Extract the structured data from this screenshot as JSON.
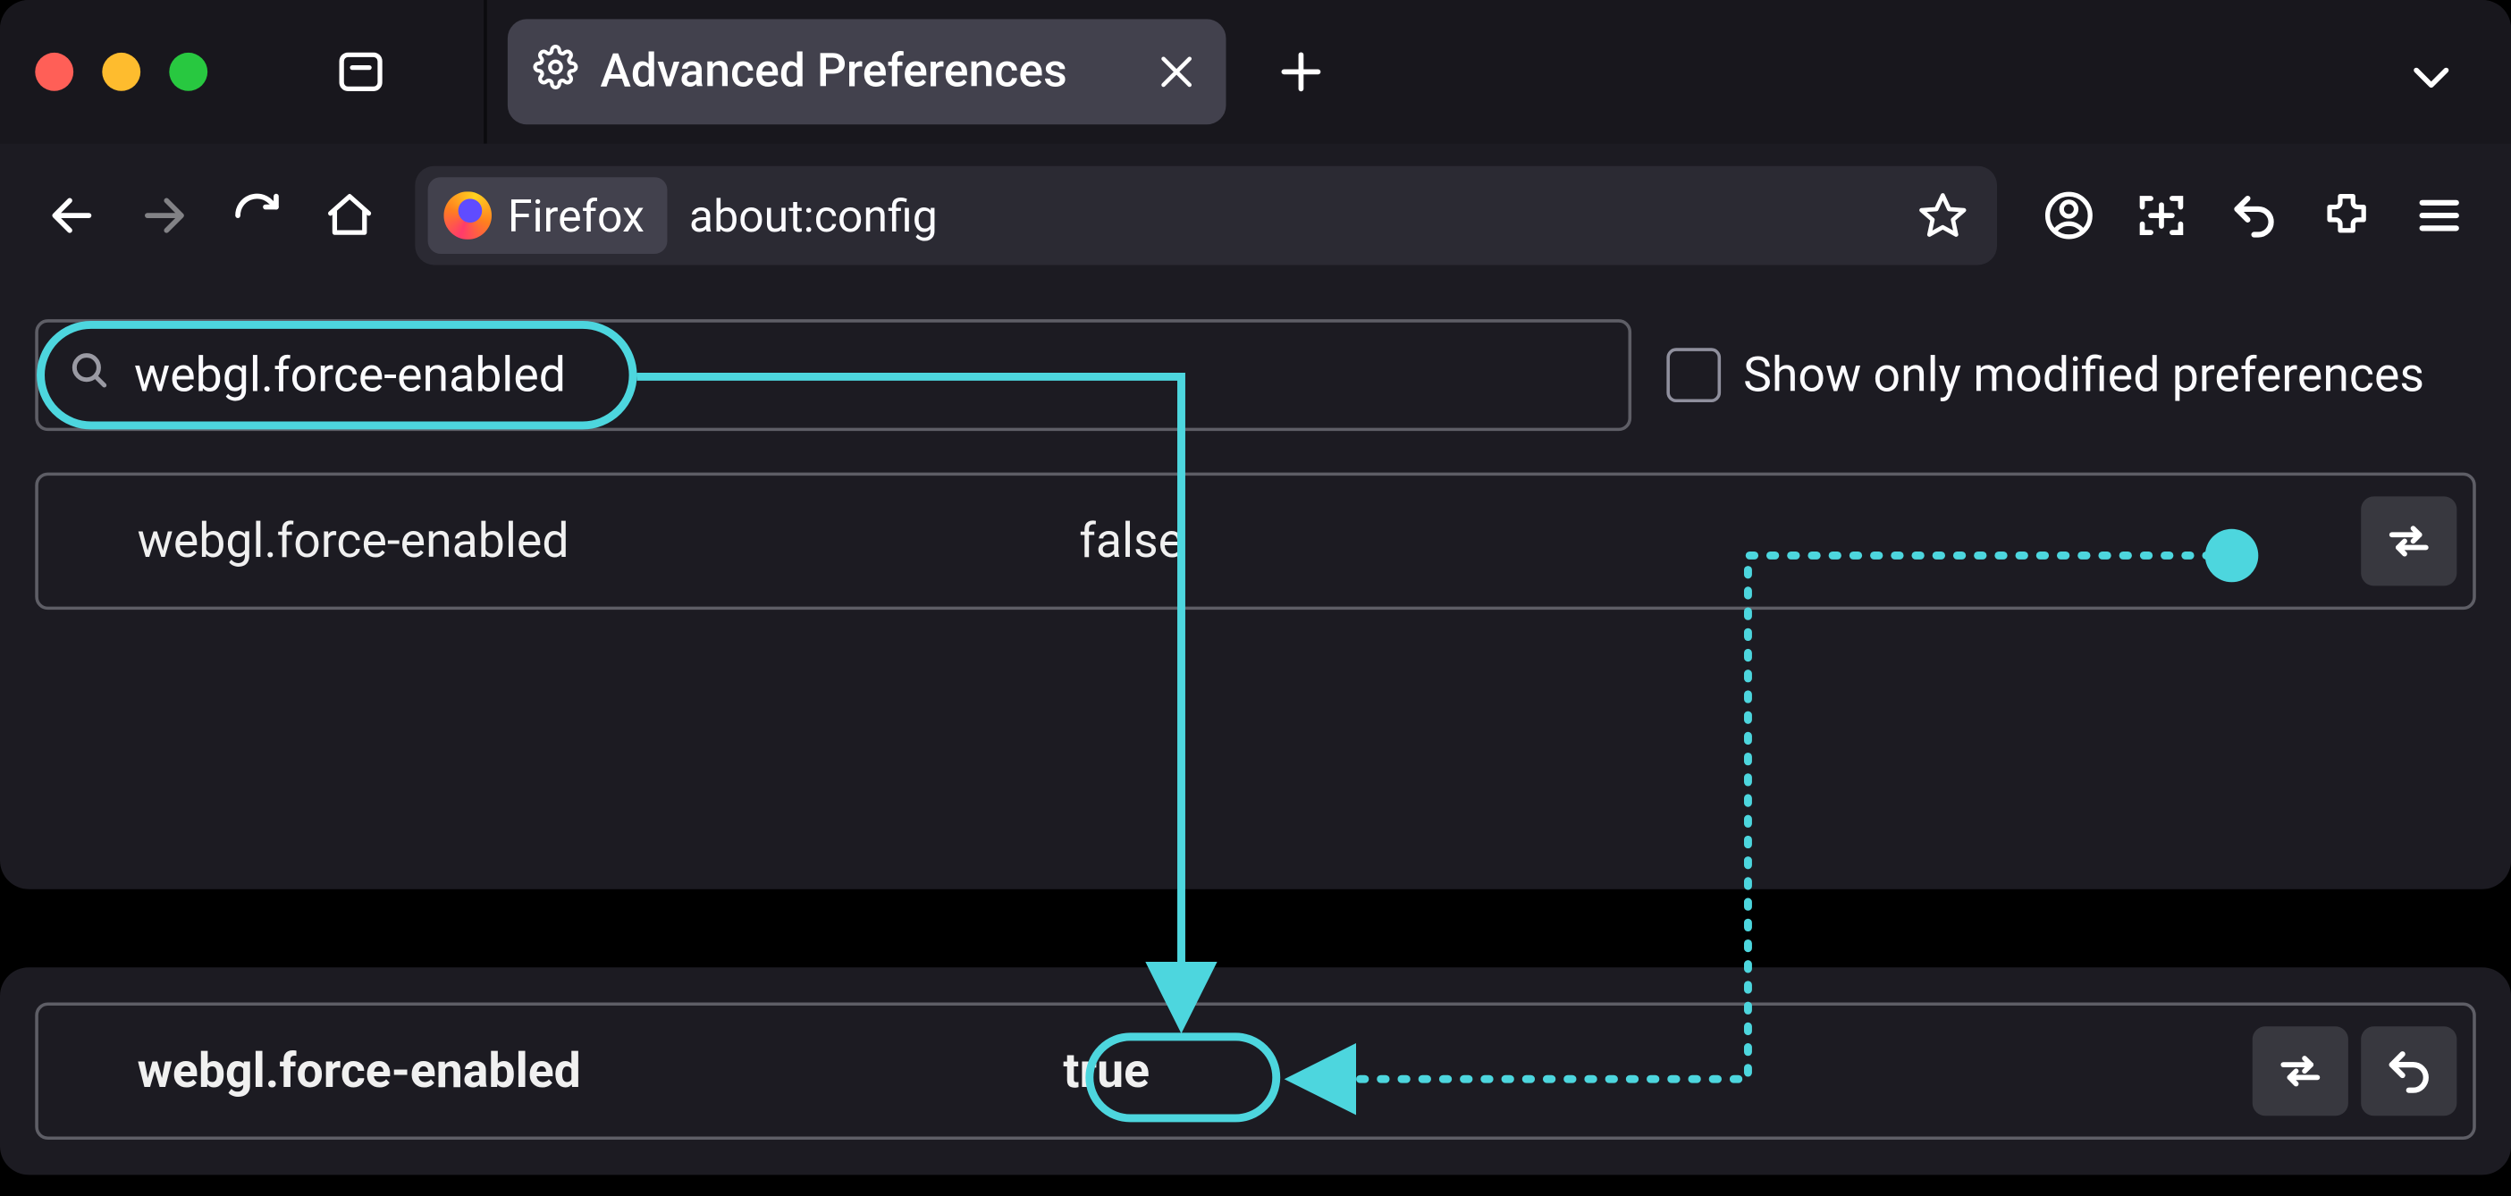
{
  "titlebar": {
    "tab_title": "Advanced Preferences"
  },
  "toolbar": {
    "identity_label": "Firefox",
    "url": "about:config"
  },
  "config": {
    "search_text": "webgl.force-enabled",
    "show_modified_label": "Show only modified preferences",
    "pref_name": "webgl.force-enabled",
    "pref_value": "false"
  },
  "result": {
    "pref_name": "webgl.force-enabled",
    "pref_value": "true"
  }
}
